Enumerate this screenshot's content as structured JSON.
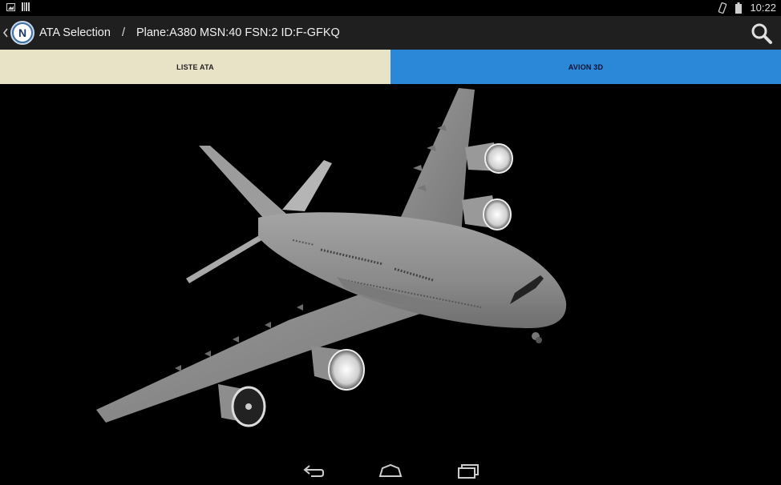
{
  "status": {
    "time": "10:22",
    "icons": [
      "image-notification-icon",
      "barcode-notification-icon",
      "screen-rotate-icon",
      "battery-icon"
    ]
  },
  "actionbar": {
    "app_logo_letter": "N",
    "title": "ATA Selection",
    "separator": "/",
    "subtitle": "Plane:A380 MSN:40 FSN:2 ID:F-GFKQ",
    "search_icon": "search-icon"
  },
  "tabs": [
    {
      "label": "LISTE ATA",
      "selected": false
    },
    {
      "label": "AVION 3D",
      "selected": true
    }
  ],
  "viewer": {
    "model": "A380 3D model",
    "colors": {
      "fuselage": "#8a8a8a",
      "background": "#000000"
    }
  },
  "navbar": {
    "icons": [
      "back-icon",
      "home-icon",
      "recent-apps-icon"
    ]
  },
  "colors": {
    "liste_tab_bg": "#e8e2c6",
    "avion_tab_bg": "#2b88d8",
    "actionbar_bg": "#1f1f1f"
  }
}
